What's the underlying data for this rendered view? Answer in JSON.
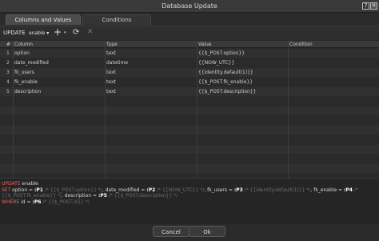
{
  "window": {
    "title": "Database Update"
  },
  "tabs": [
    {
      "label": "Columns and Values",
      "active": true
    },
    {
      "label": "Conditions",
      "active": false
    }
  ],
  "toolbar": {
    "keyword": "UPDATE",
    "table": "enable",
    "add_icon": "plus-icon",
    "refresh_icon": "refresh-icon",
    "delete_icon": "close-icon"
  },
  "grid": {
    "headers": [
      "#",
      "Column",
      "Type",
      "Value",
      "Condition"
    ],
    "rows": [
      {
        "idx": "1",
        "column": "option",
        "type": "text",
        "value": "{{$_POST.option}}",
        "condition": ""
      },
      {
        "idx": "2",
        "column": "date_modified",
        "type": "datetime",
        "value": "{{NOW_UTC}}",
        "condition": ""
      },
      {
        "idx": "3",
        "column": "fk_users",
        "type": "text",
        "value": "{{identity.default(1)}}",
        "condition": ""
      },
      {
        "idx": "4",
        "column": "fk_enable",
        "type": "text",
        "value": "{{$_POST.fk_enable}}",
        "condition": ""
      },
      {
        "idx": "5",
        "column": "description",
        "type": "text",
        "value": "{{$_POST.description}}",
        "condition": ""
      }
    ]
  },
  "sql": {
    "line1_kw": "UPDATE",
    "line1_txt": " enable",
    "line2_kw": "SET",
    "line2_a": " option = ",
    "p1": ":P1",
    "c1": " /* {{$_POST.option}} */",
    "line2_b": ", date_modified = ",
    "p2": ":P2",
    "c2": " /* {{NOW_UTC}} */",
    "line2_c": ", fk_users = ",
    "p3": ":P3",
    "c3": " /* {{identity.default(1)}} */",
    "line2_d": ", fk_enable = ",
    "p4": ":P4",
    "c4": " /*",
    "line3_c": "{{$_POST.fk_enable}} */",
    "line3_a": ", description = ",
    "p5": ":P5",
    "c5": " /* {{$_POST.description}} */",
    "line4_kw": "WHERE",
    "line4_a": " id = ",
    "p6": ":P6",
    "c6": " /* {{$_POST.id}} */"
  },
  "footer": {
    "cancel_label": "Cancel",
    "ok_label": "Ok"
  },
  "colors": {
    "sql_keyword": "#ff5a5a",
    "background": "#2b2b2b"
  }
}
